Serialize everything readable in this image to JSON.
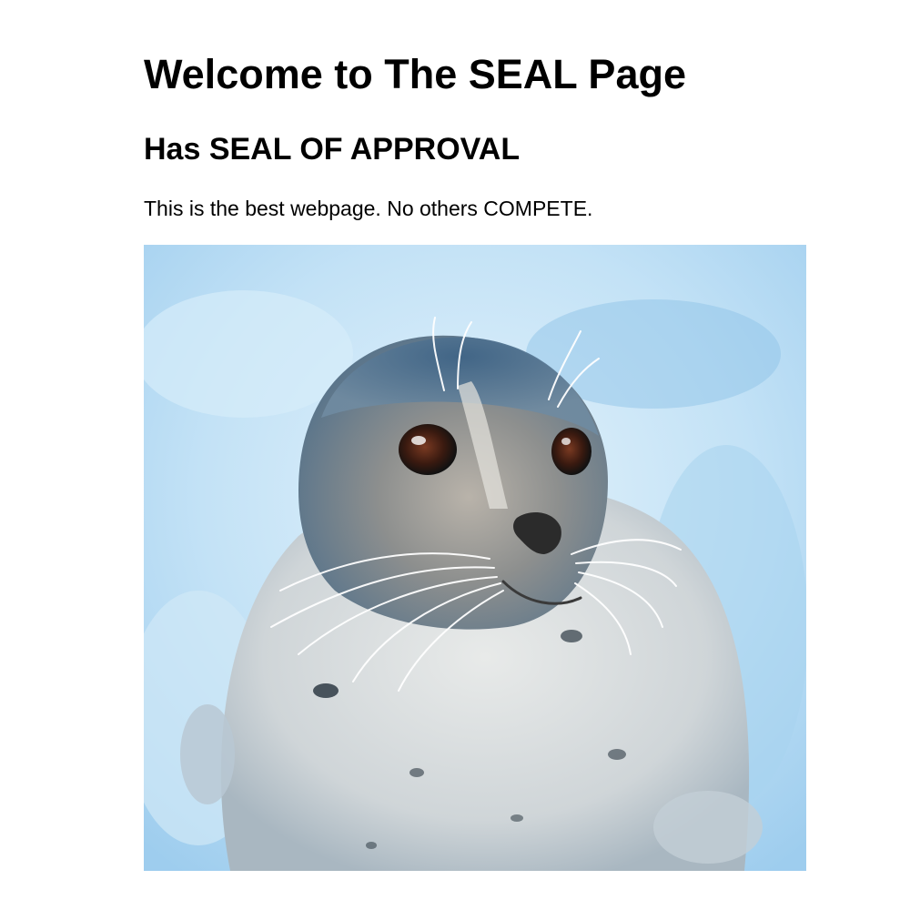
{
  "page": {
    "title": "Welcome to The SEAL Page",
    "subtitle": "Has SEAL OF APPROVAL",
    "text": "This is the best webpage. No others COMPETE."
  },
  "image": {
    "alt": "Harbor seal",
    "icon": "seal-photo"
  },
  "colors": {
    "background": "#ffffff",
    "text": "#000000",
    "ice": "#bfe0f5",
    "seal_body": "#d9dde0",
    "seal_head": "#5f7d96"
  }
}
